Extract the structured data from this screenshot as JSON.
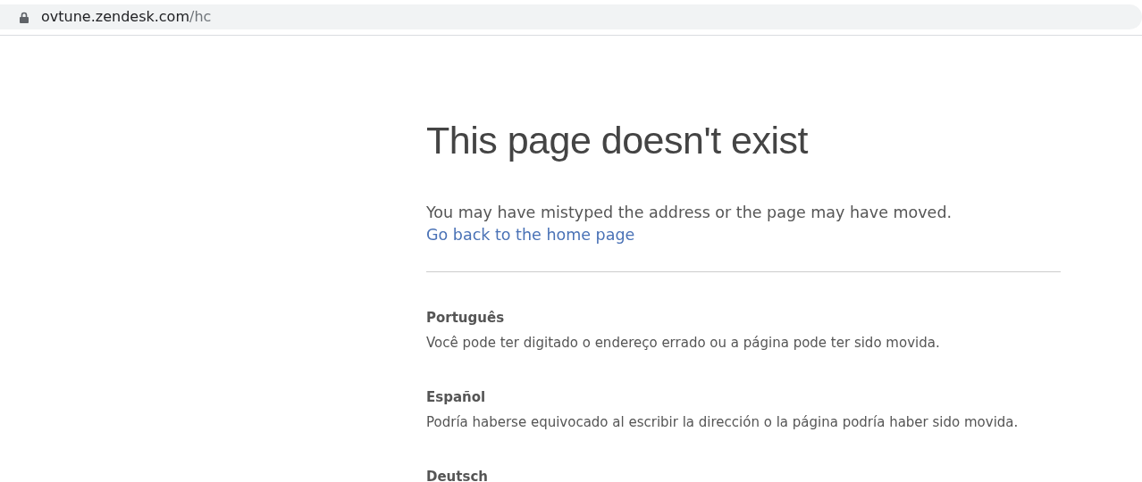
{
  "address_bar": {
    "host": "ovtune.zendesk.com",
    "path": "/hc",
    "secure": true
  },
  "title": "This page doesn't exist",
  "message": "You may have mistyped the address or the page may have moved.",
  "home_link": "Go back to the home page",
  "translations": [
    {
      "language": "Português",
      "message": "Você pode ter digitado o endereço errado ou a página pode ter sido movida."
    },
    {
      "language": "Español",
      "message": "Podría haberse equivocado al escribir la dirección o la página podría haber sido movida."
    },
    {
      "language": "Deutsch"
    }
  ]
}
